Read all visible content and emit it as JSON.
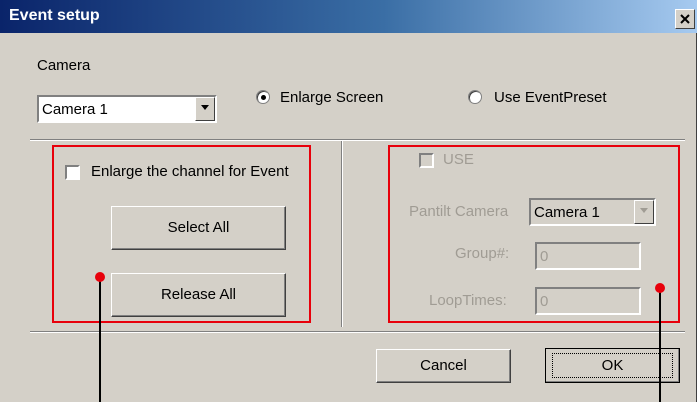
{
  "window": {
    "title": "Event setup",
    "close_glyph": "close-icon"
  },
  "camera": {
    "label": "Camera",
    "selected": "Camera 1"
  },
  "mode": {
    "enlarge_label": "Enlarge Screen",
    "enlarge_checked": true,
    "preset_label": "Use EventPreset",
    "preset_checked": false
  },
  "left_panel": {
    "checkbox_label": "Enlarge the channel for Event",
    "select_all": "Select All",
    "release_all": "Release All"
  },
  "right_panel": {
    "use_label": "USE",
    "pantilt_label": "Pantilt Camera",
    "pantilt_value": "Camera 1",
    "group_label": "Group#:",
    "group_value": "0",
    "loop_label": "LoopTimes:",
    "loop_value": "0"
  },
  "footer": {
    "cancel": "Cancel",
    "ok": "OK"
  },
  "colors": {
    "annotation": "#e8000b",
    "titlebar_start": "#0a246a",
    "titlebar_end": "#a6caf0"
  }
}
